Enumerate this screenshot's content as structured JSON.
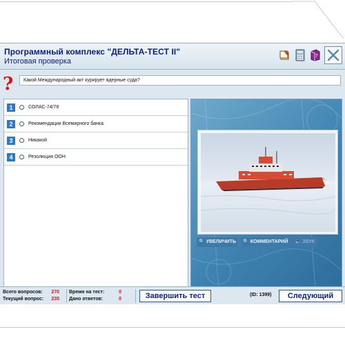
{
  "window": {
    "title": "Программный комплекс \"ДЕЛЬТА-ТЕСТ II\"",
    "subtitle": "Итоговая проверка"
  },
  "toolbar": {
    "icons": [
      "notebook-icon",
      "calculator-icon",
      "reference-book-icon"
    ],
    "close_icon": "close-icon"
  },
  "question": {
    "text": "Какой Международный акт курирует ядерные суда?"
  },
  "answers": [
    {
      "num": "1",
      "text": "СОЛАС-74/78"
    },
    {
      "num": "2",
      "text": "Рекомендации Всемирного банка"
    },
    {
      "num": "3",
      "text": "Никакой"
    },
    {
      "num": "4",
      "text": "Резолюция ООН"
    }
  ],
  "media": {
    "zoom_label": "УВЕЛИЧИТЬ",
    "comment_label": "КОММЕНТАРИЙ",
    "sound_label": "ЗВУК"
  },
  "status": {
    "total_label": "Всего вопросов:",
    "total_value": "270",
    "current_label": "Текущий вопрос:",
    "current_value": "235",
    "time_label": "Время на тест:",
    "time_value": "0",
    "answered_label": "Дано ответов:",
    "answered_value": "0",
    "id_text": "(ID: 1399)"
  },
  "buttons": {
    "finish": "Завершить тест",
    "next": "Следующий"
  },
  "colors": {
    "accent": "#0a1e8a",
    "number_badge": "#2e79c7",
    "counter_red": "#e01010"
  }
}
